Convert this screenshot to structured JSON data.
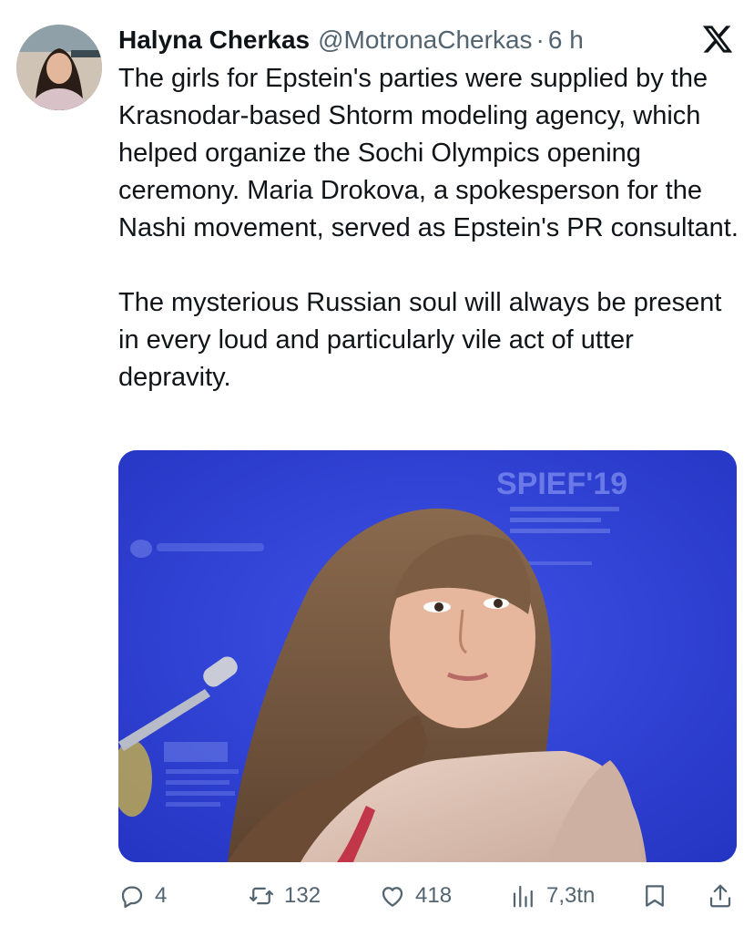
{
  "tweet": {
    "author": {
      "display_name": "Halyna Cherkas",
      "handle": "@MotronaCherkas",
      "time": "6 h"
    },
    "separator": "·",
    "paragraphs": [
      "The girls for Epstein's parties were supplied by the Krasnodar-based Shtorm modeling agency, which helped organize the Sochi Olympics opening ceremony. Maria Drokova, a spokesperson for the Nashi movement, served as Epstein's PR consultant.",
      "The mysterious Russian soul will always be present in every loud and particularly vile act of utter depravity."
    ],
    "media": {
      "backdrop_text": "SPIEF'19",
      "background_color": "#2d3fd4"
    },
    "actions": {
      "replies": "4",
      "retweets": "132",
      "likes": "418",
      "views": "7,3tn"
    }
  },
  "icons": [
    "x-logo-icon",
    "reply-icon",
    "retweet-icon",
    "like-icon",
    "views-icon",
    "bookmark-icon",
    "share-icon"
  ],
  "colors": {
    "text": "#0f1419",
    "secondary": "#536471"
  }
}
